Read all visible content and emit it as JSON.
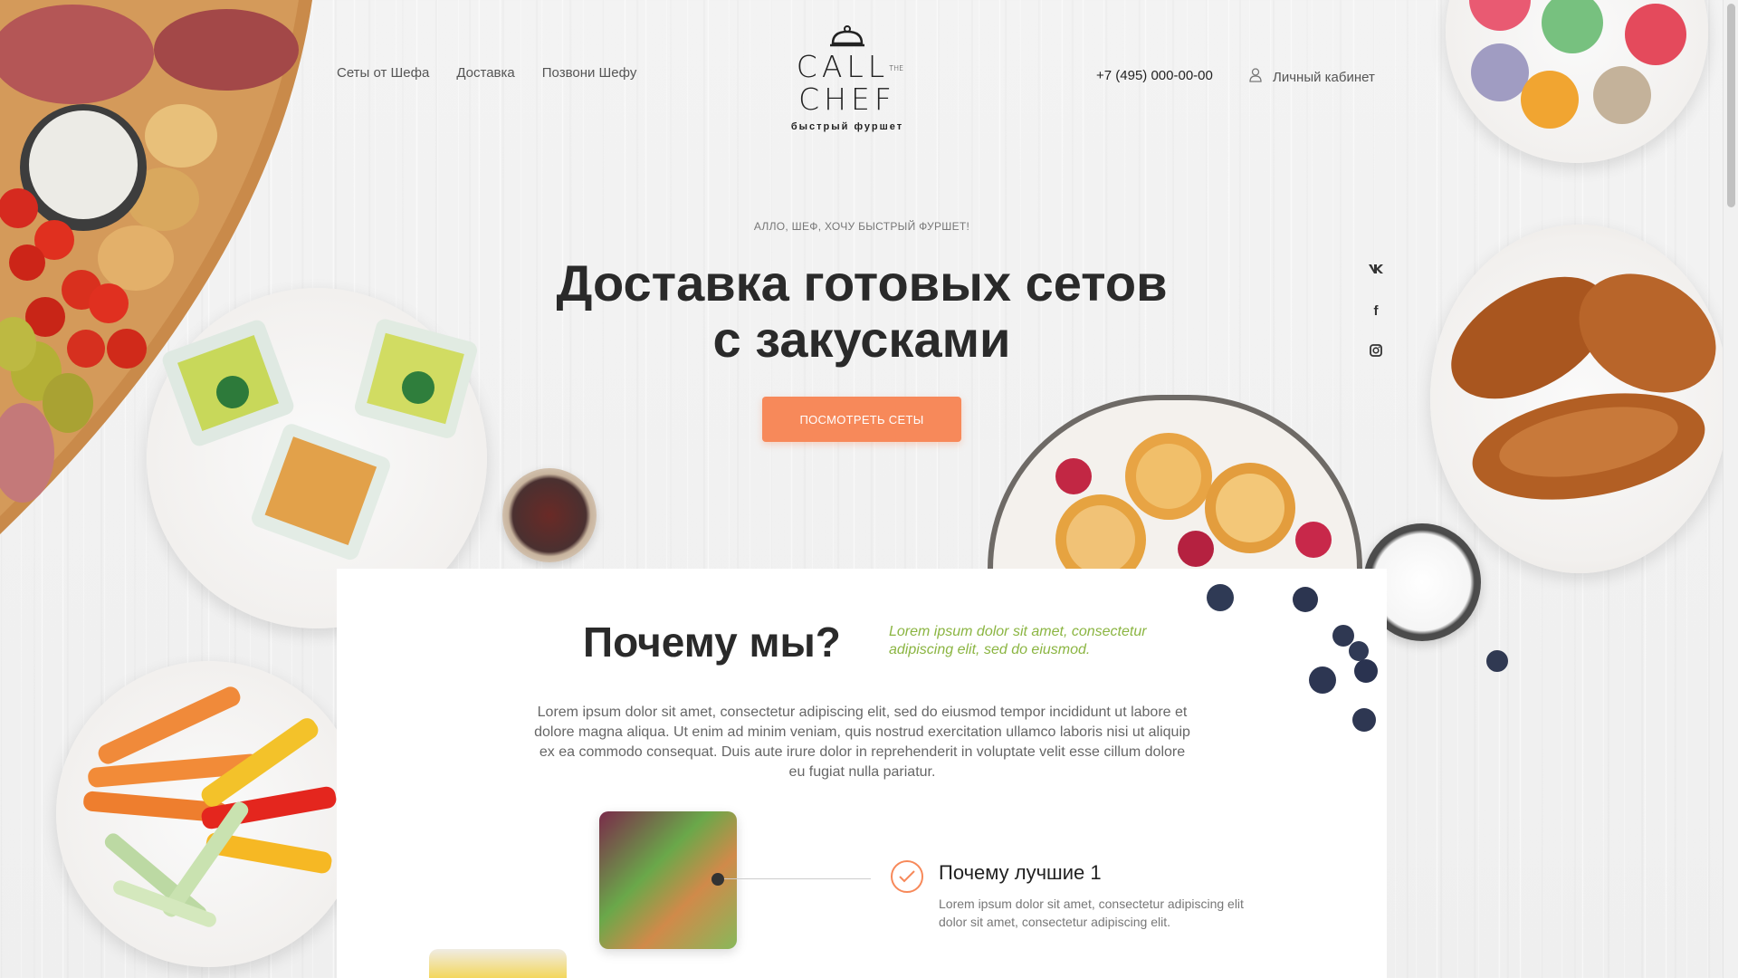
{
  "nav": {
    "items": [
      "Сеты от Шефа",
      "Доставка",
      "Позвони Шефу"
    ]
  },
  "logo": {
    "call": "CALL",
    "the": "THE",
    "chef": "CHEF",
    "tagline": "быстрый фуршет"
  },
  "header": {
    "phone": "+7 (495) 000-00-00",
    "account_label": "Личный кабинет"
  },
  "hero": {
    "eyebrow": "АЛЛО, ШЕФ, ХОЧУ БЫСТРЫЙ ФУРШЕТ!",
    "title_line1": "Доставка готовых сетов",
    "title_line2": "с закусками",
    "cta_label": "ПОСМОТРЕТЬ СЕТЫ"
  },
  "social": {
    "vk": "vk",
    "facebook": "f",
    "instagram": "◻"
  },
  "why": {
    "title": "Почему мы?",
    "subtitle": "Lorem ipsum dolor sit amet, consectetur adipiscing elit, sed do eiusmod.",
    "text": "Lorem ipsum dolor sit amet, consectetur adipiscing elit, sed do eiusmod tempor incididunt ut labore et dolore magna aliqua. Ut enim ad minim veniam, quis nostrud exercitation ullamco laboris nisi ut aliquip ex ea commodo consequat. Duis aute irure dolor in reprehenderit in voluptate velit esse cillum dolore eu fugiat nulla pariatur."
  },
  "feature": {
    "title": "Почему лучшие 1",
    "text": "Lorem ipsum dolor sit amet, consectetur adipiscing elit dolor sit amet, consectetur adipiscing elit."
  },
  "colors": {
    "accent": "#f7895a",
    "green": "#8bb542"
  },
  "icons": [
    "user-icon",
    "vk-icon",
    "facebook-icon",
    "instagram-icon",
    "check-icon",
    "cloche-icon"
  ]
}
